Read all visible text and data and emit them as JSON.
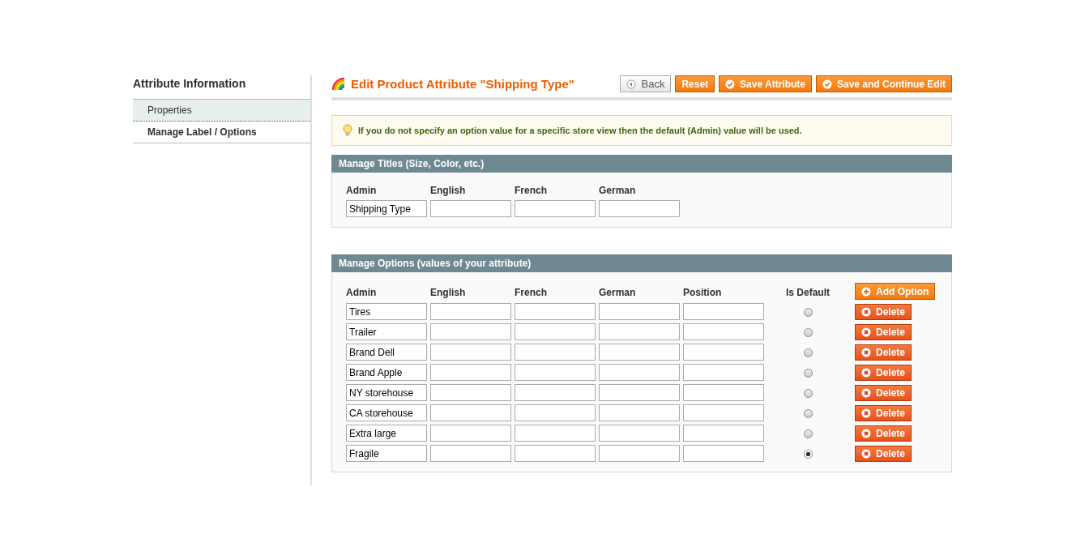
{
  "sidebar": {
    "title": "Attribute Information",
    "tabs": [
      {
        "label": "Properties",
        "selected": false
      },
      {
        "label": "Manage Label / Options",
        "selected": true
      }
    ]
  },
  "header": {
    "title": "Edit Product Attribute \"Shipping Type\"",
    "buttons": [
      {
        "label": "Back",
        "kind": "back"
      },
      {
        "label": "Reset",
        "kind": "plain"
      },
      {
        "label": "Save Attribute",
        "kind": "save"
      },
      {
        "label": "Save and Continue Edit",
        "kind": "save"
      }
    ]
  },
  "notice": "If you do not specify an option value for a specific store view then the default (Admin) value will be used.",
  "titles": {
    "heading": "Manage Titles (Size, Color, etc.)",
    "columns": [
      "Admin",
      "English",
      "French",
      "German"
    ],
    "admin_value": "Shipping Type"
  },
  "options": {
    "heading": "Manage Options (values of your attribute)",
    "columns": [
      "Admin",
      "English",
      "French",
      "German",
      "Position",
      "Is Default"
    ],
    "add_button": "Add Option",
    "rows": [
      {
        "admin": "Tires",
        "selected": false,
        "delete": "Delete"
      },
      {
        "admin": "Trailer",
        "selected": false,
        "delete": "Delete"
      },
      {
        "admin": "Brand Dell",
        "selected": false,
        "delete": "Delete"
      },
      {
        "admin": "Brand Apple",
        "selected": false,
        "delete": "Delete"
      },
      {
        "admin": "NY storehouse",
        "selected": false,
        "delete": "Delete"
      },
      {
        "admin": "CA storehouse",
        "selected": false,
        "delete": "Delete"
      },
      {
        "admin": "Extra large",
        "selected": false,
        "delete": "Delete"
      },
      {
        "admin": "Fragile",
        "selected": true,
        "delete": "Delete"
      }
    ]
  }
}
